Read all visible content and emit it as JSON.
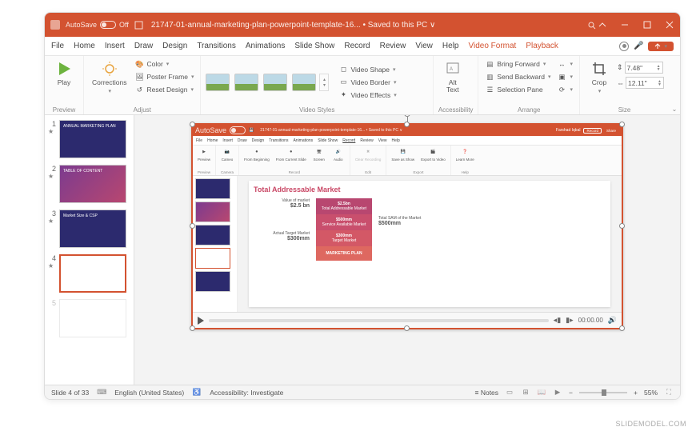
{
  "titlebar": {
    "autosave_label": "AutoSave",
    "autosave_state": "Off",
    "doc_title": "21747-01-annual-marketing-plan-powerpoint-template-16... • Saved to this PC ∨"
  },
  "tabs": {
    "file": "File",
    "home": "Home",
    "insert": "Insert",
    "draw": "Draw",
    "design": "Design",
    "transitions": "Transitions",
    "animations": "Animations",
    "slideshow": "Slide Show",
    "record": "Record",
    "review": "Review",
    "view": "View",
    "help": "Help",
    "video_format": "Video Format",
    "playback": "Playback"
  },
  "ribbon": {
    "play": "Play",
    "corrections": "Corrections",
    "color": "Color",
    "poster_frame": "Poster Frame",
    "reset_design": "Reset Design",
    "video_shape": "Video Shape",
    "video_border": "Video Border",
    "video_effects": "Video Effects",
    "alt_text": "Alt\nText",
    "bring_forward": "Bring Forward",
    "send_backward": "Send Backward",
    "selection_pane": "Selection Pane",
    "align": "",
    "group_btn": "",
    "rotate": "",
    "crop": "Crop",
    "height": "7.48\"",
    "width": "12.11\"",
    "groups": {
      "preview": "Preview",
      "adjust": "Adjust",
      "video_styles": "Video Styles",
      "accessibility": "Accessibility",
      "arrange": "Arrange",
      "size": "Size"
    }
  },
  "thumbs": [
    {
      "num": "1",
      "title": "ANNUAL MARKETING PLAN"
    },
    {
      "num": "2",
      "title": "TABLE OF CONTENT"
    },
    {
      "num": "3",
      "title": "Market Size & CSP"
    },
    {
      "num": "4",
      "title": ""
    },
    {
      "num": "5",
      "title": ""
    }
  ],
  "inner": {
    "titlebar": {
      "autosave": "AutoSave",
      "title": "21747-01-annual-marketing-plan-powerpoint-template-16... • Saved to this PC ∨",
      "user": "Farshad Iqbal",
      "record": "Record",
      "share": "Share"
    },
    "tabs": [
      "File",
      "Home",
      "Insert",
      "Draw",
      "Design",
      "Transitions",
      "Animations",
      "Slide Show",
      "Record",
      "Review",
      "View",
      "Help"
    ],
    "ribbon_btns": [
      "Preview",
      "Cameo",
      "From Beginning",
      "From Current Slide",
      "Screen",
      "Audio",
      "Clear Recording",
      "Save as Show",
      "Export to Video",
      "Learn More"
    ],
    "ribbon_groups": [
      "Preview",
      "Camera",
      "Record",
      "Edit",
      "Export",
      "Help"
    ],
    "slide": {
      "title": "Total Addressable Market",
      "left1_lbl": "Value of market",
      "left1_val": "$2.5 bn",
      "left2_lbl": "Actual Target Market",
      "left2_val": "$300mm",
      "box1_val": "$2.5bn",
      "box1_lbl": "Total Addressable Market",
      "box2_val": "$500mm",
      "box2_lbl": "Service Available Market",
      "box3_val": "$300mm",
      "box3_lbl": "Target Market",
      "box4": "MARKETING PLAN",
      "right_lbl": "Total SAM of the Market",
      "right_val": "$500mm"
    }
  },
  "video_ctrl": {
    "time": "00:00.00"
  },
  "statusbar": {
    "slide_count": "Slide 4 of 33",
    "language": "English (United States)",
    "accessibility": "Accessibility: Investigate",
    "notes": "Notes",
    "zoom": "55%"
  },
  "watermark": "SLIDEMODEL.COM"
}
